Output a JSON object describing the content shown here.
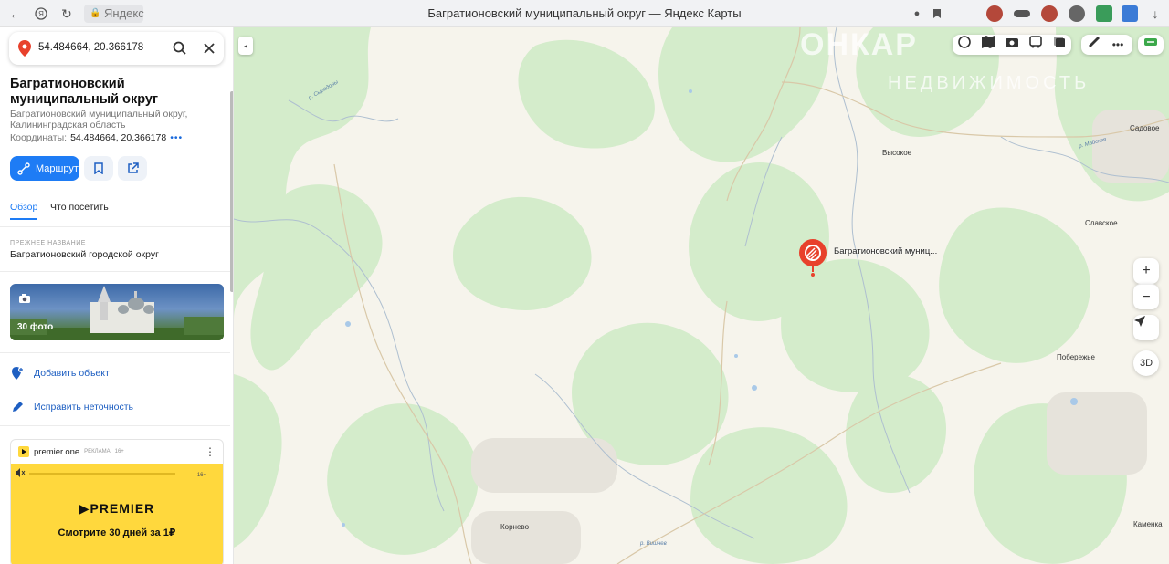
{
  "browser": {
    "url_label": "Яндекс",
    "tab_title": "Багратионовский муниципальный округ — Яндекс Карты"
  },
  "search": {
    "value": "54.484664, 20.366178"
  },
  "place": {
    "title": "Багратионовский муниципальный округ",
    "subtitle": "Багратионовский муниципальный округ, Калининградская область",
    "coords_label": "Координаты:",
    "coords_value": "54.484664, 20.366178",
    "route_label": "Маршрут"
  },
  "tabs": [
    "Обзор",
    "Что посетить"
  ],
  "former": {
    "heading": "ПРЕЖНЕЕ НАЗВАНИЕ",
    "value": "Багратионовский городской округ"
  },
  "photo": {
    "count_label": "30 фото"
  },
  "actions": {
    "add": "Добавить объект",
    "fix": "Исправить неточность"
  },
  "ad": {
    "advertiser": "premier.one",
    "tag": "РЕКЛАМА",
    "age_head": "16+",
    "age_banner": "16+",
    "logo": "▶PREMIER",
    "promo": "Смотрите 30 дней за 1₽"
  },
  "map": {
    "place_label": "Багратионовский муниц...",
    "controls": {
      "zoom_in": "+",
      "zoom_out": "−",
      "mode_3d": "3D"
    },
    "towns": [
      "Высокое",
      "Садовое",
      "Славское",
      "Побережье",
      "Корнево",
      "Каменка"
    ],
    "rivers": [
      "р. Сырадоны",
      "р. Майская",
      "р. Вишнев"
    ],
    "watermark_top": "ОНКАР",
    "watermark_bottom": "НЕДВИЖИМОСТЬ"
  },
  "colors": {
    "accent": "#1e7cf5",
    "forest": "#d4eccb",
    "marker": "#e8412c",
    "ad_bg": "#ffd83d"
  }
}
